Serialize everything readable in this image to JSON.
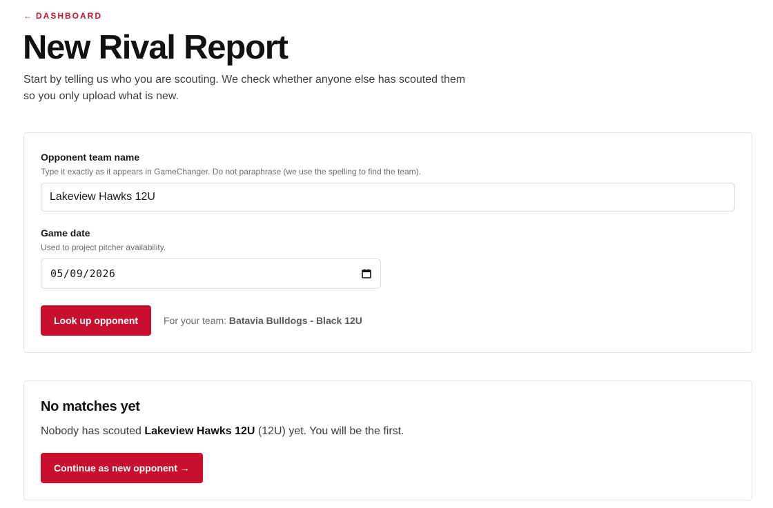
{
  "nav": {
    "back_arrow": "←",
    "back_label": "DASHBOARD"
  },
  "page": {
    "title": "New Rival Report",
    "intro": "Start by telling us who you are scouting. We check whether anyone else has scouted them so you only upload what is new."
  },
  "form": {
    "opponent": {
      "label": "Opponent team name",
      "help": "Type it exactly as it appears in GameChanger. Do not paraphrase (we use the spelling to find the team).",
      "value": "Lakeview Hawks 12U"
    },
    "game_date": {
      "label": "Game date",
      "help": "Used to project pitcher availability.",
      "value": "05/09/2026",
      "icon": "calendar-icon"
    },
    "lookup_button": "Look up opponent",
    "team_note_prefix": "For your team:",
    "team_name": "Batavia Bulldogs - Black 12U"
  },
  "result": {
    "title": "No matches yet",
    "text_prefix": "Nobody has scouted",
    "opponent_name": "Lakeview Hawks 12U",
    "text_suffix": "(12U) yet. You will be the first.",
    "continue_button": "Continue as new opponent →"
  },
  "colors": {
    "accent": "#c8102e",
    "text": "#1a1a1a",
    "muted": "#6b6b6b",
    "border": "#e3e3e3"
  }
}
